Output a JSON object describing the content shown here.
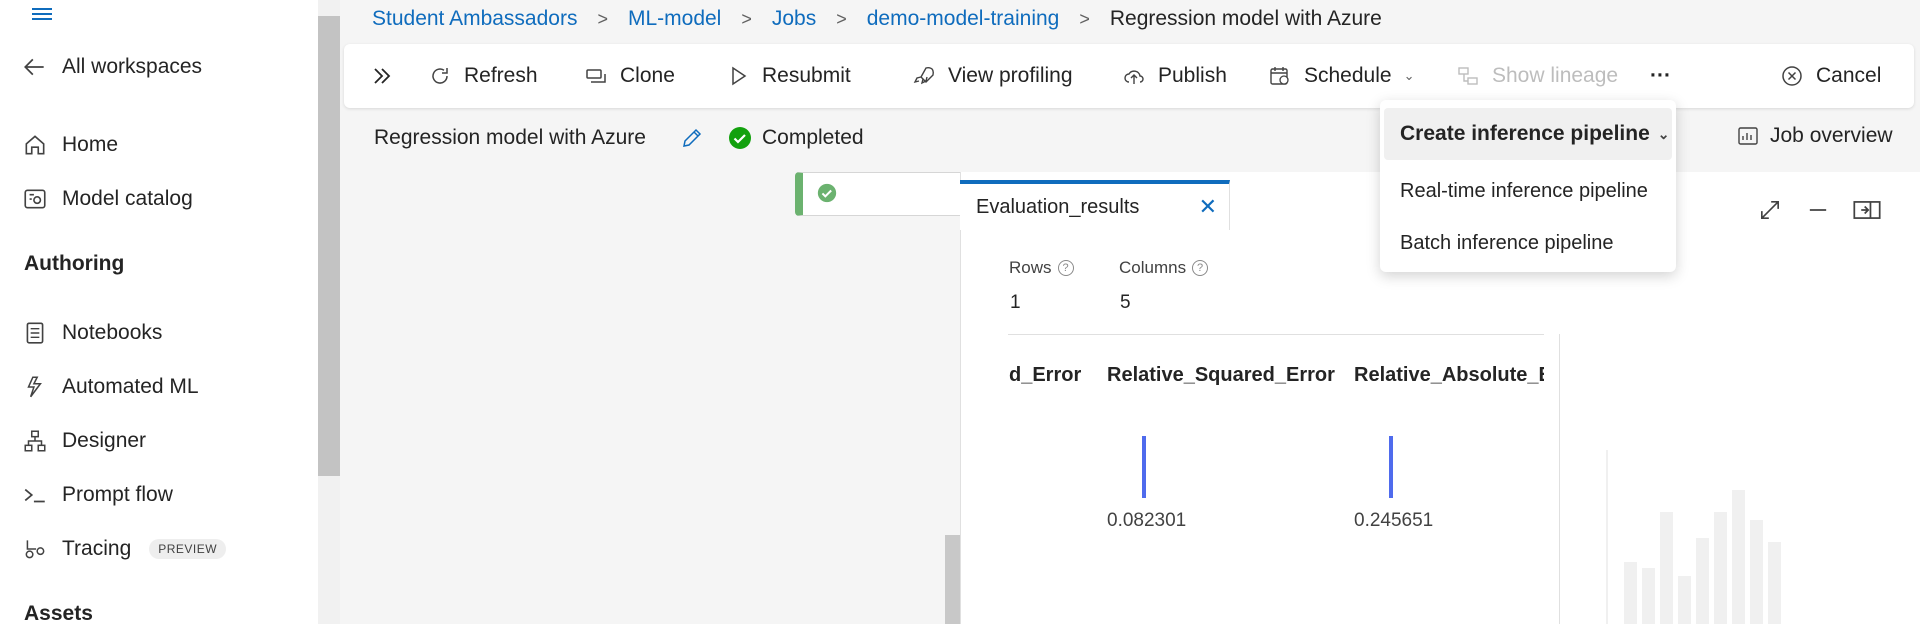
{
  "sidebar": {
    "back_label": "All workspaces",
    "items": [
      {
        "label": "Home",
        "icon": "home-icon"
      },
      {
        "label": "Model catalog",
        "icon": "model-catalog-icon"
      }
    ],
    "authoring_heading": "Authoring",
    "authoring_items": [
      {
        "label": "Notebooks",
        "icon": "notebook-icon"
      },
      {
        "label": "Automated ML",
        "icon": "automated-ml-icon"
      },
      {
        "label": "Designer",
        "icon": "designer-icon"
      },
      {
        "label": "Prompt flow",
        "icon": "prompt-flow-icon"
      },
      {
        "label": "Tracing",
        "icon": "tracing-icon",
        "badge": "PREVIEW"
      }
    ],
    "assets_heading": "Assets"
  },
  "breadcrumb": {
    "items": [
      "Student Ambassadors",
      "ML-model",
      "Jobs",
      "demo-model-training"
    ],
    "current": "Regression model with Azure"
  },
  "toolbar": {
    "refresh": "Refresh",
    "clone": "Clone",
    "resubmit": "Resubmit",
    "view_profiling": "View profiling",
    "publish": "Publish",
    "schedule": "Schedule",
    "show_lineage": "Show lineage",
    "more": "···",
    "cancel": "Cancel"
  },
  "job": {
    "title": "Regression model with Azure",
    "status": "Completed",
    "status_color": "#13a10e",
    "job_overview": "Job overview"
  },
  "dropdown": {
    "header": "Create inference pipeline",
    "items": [
      "Real-time inference pipeline",
      "Batch inference pipeline"
    ]
  },
  "panel": {
    "tab_title": "Evaluation_results",
    "rows_label": "Rows",
    "rows_value": "1",
    "columns_label": "Columns",
    "columns_value": "5",
    "columns": [
      {
        "header": "d_Error",
        "value": ""
      },
      {
        "header": "Relative_Squared_Error",
        "value": "0.082301"
      },
      {
        "header": "Relative_Absolute_Error",
        "value": "0.245651"
      }
    ],
    "accent": "#0f6cbd",
    "bar_color": "#4f6bed"
  }
}
